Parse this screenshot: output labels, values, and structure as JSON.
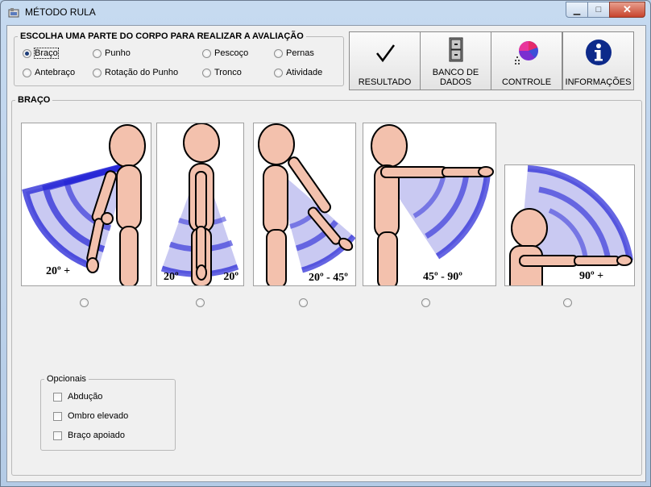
{
  "window": {
    "title": "MÉTODO RULA",
    "minimize": "▁",
    "maximize": "□",
    "close": "✕"
  },
  "body_group": {
    "legend": "ESCOLHA UMA PARTE DO CORPO PARA REALIZAR A AVALIAÇÃO",
    "options": [
      {
        "label": "Braço",
        "checked": true
      },
      {
        "label": "Punho",
        "checked": false
      },
      {
        "label": "Pescoço",
        "checked": false
      },
      {
        "label": "Pernas",
        "checked": false
      },
      {
        "label": "Antebraço",
        "checked": false
      },
      {
        "label": "Rotação do Punho",
        "checked": false
      },
      {
        "label": "Tronco",
        "checked": false
      },
      {
        "label": "Atividade",
        "checked": false
      }
    ]
  },
  "toolbar": {
    "resultado": "RESULTADO",
    "banco_line1": "BANCO DE",
    "banco_line2": "DADOS",
    "controle": "CONTROLE",
    "informacoes": "INFORMAÇÕES"
  },
  "braco_panel": {
    "legend": "BRAÇO",
    "images": [
      {
        "label": "20º +"
      },
      {
        "label_left": "20º",
        "label_right": "20º"
      },
      {
        "label": "20º - 45º"
      },
      {
        "label": "45º - 90º"
      },
      {
        "label": "90º +"
      }
    ]
  },
  "opcionais": {
    "legend": "Opcionais",
    "items": [
      {
        "label": "Abdução"
      },
      {
        "label": "Ombro elevado"
      },
      {
        "label": "Braço apoiado"
      }
    ]
  },
  "colors": {
    "accent": "#1c3c78",
    "skin": "#f3c1ad",
    "arc_blue": "#2b2bd9"
  }
}
